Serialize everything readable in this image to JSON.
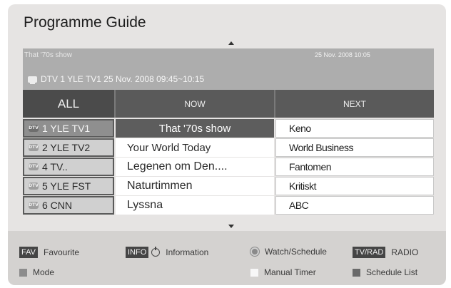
{
  "title": "Programme Guide",
  "info": {
    "programme": "That '70s show",
    "datetime": "25 Nov. 2008 10:05",
    "details": "DTV  1 YLE TV1 25 Nov. 2008 09:45~10:15"
  },
  "tabs": {
    "all": "ALL",
    "now": "NOW",
    "next": "NEXT"
  },
  "channel_icon_text": "DTV",
  "rows": [
    {
      "channel": "1  YLE TV1",
      "now": "That '70s show",
      "next": "Keno"
    },
    {
      "channel": "2  YLE TV2",
      "now": "Your World Today",
      "next": "World Business"
    },
    {
      "channel": "4  TV..",
      "now": "Legenen om Den....",
      "next": "Fantomen"
    },
    {
      "channel": "5  YLE FST",
      "now": "Naturtimmen",
      "next": "Kritiskt"
    },
    {
      "channel": "6  CNN",
      "now": "Lyssna",
      "next": "ABC"
    }
  ],
  "footer": {
    "fav_key": "FAV",
    "fav_label": "Favourite",
    "info_key": "INFO",
    "info_label": "Information",
    "watch_label": "Watch/Schedule",
    "tvrad_key": "TV/RAD",
    "tvrad_label": "RADIO",
    "mode_label": "Mode",
    "manual_label": "Manual Timer",
    "schedule_label": "Schedule List"
  },
  "colors": {
    "red_key": "#8c8c8c",
    "yellow_key": "#f7f7f7",
    "blue_key": "#6a6a6a"
  }
}
